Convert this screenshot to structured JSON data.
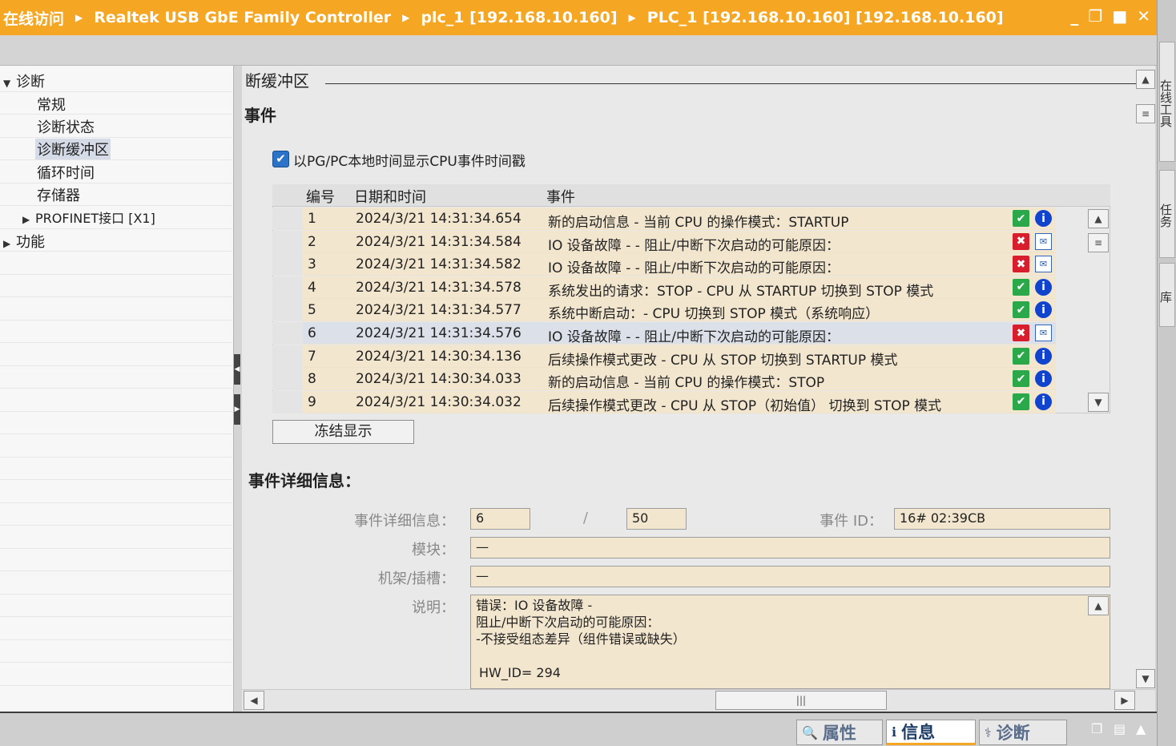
{
  "titlebar": {
    "crumbs": [
      "在线访问",
      "Realtek USB GbE Family Controller",
      "plc_1 [192.168.10.160]",
      "PLC_1 [192.168.10.160] [192.168.10.160]"
    ],
    "minimize": "_",
    "restore": "❐",
    "maximize": "■",
    "close": "✕"
  },
  "right_tabs": [
    "在线工具",
    "任务",
    "库"
  ],
  "tree": {
    "diag": "诊断",
    "general": "常规",
    "status": "诊断状态",
    "buffer": "诊断缓冲区",
    "cycle": "循环时间",
    "memory": "存储器",
    "profinet": "PROFINET接口 [X1]",
    "function": "功能"
  },
  "main": {
    "section_title": "断缓冲区",
    "events_title": "事件",
    "checkbox_label": "以PG/PC本地时间显示CPU事件时间戳",
    "checkbox_checked": true,
    "columns": [
      "编号",
      "日期和时间",
      "事件"
    ],
    "freeze_button": "冻结显示",
    "detail_title": "事件详细信息：",
    "detail": {
      "detail_label": "事件详细信息：",
      "detail_value": "6",
      "slash": "/",
      "total_value": "50",
      "event_id_label": "事件 ID：",
      "event_id_value": "16# 02:39CB",
      "module_label": "模块：",
      "module_value": "—",
      "rack_label": "机架/插槽：",
      "rack_value": "—",
      "desc_label": "说明：",
      "desc_lines": [
        "错误：IO 设备故障 -",
        "阻止/中断下次启动的可能原因：",
        "-不接受组态差异（组件错误或缺失）",
        "",
        "HW_ID=  294"
      ]
    }
  },
  "events": [
    {
      "no": "1",
      "datetime": "2024/3/21 14:31:34.654",
      "event": "新的启动信息 - 当前 CPU 的操作模式：STARTUP",
      "icons": [
        "ok",
        "info"
      ]
    },
    {
      "no": "2",
      "datetime": "2024/3/21 14:31:34.584",
      "event": "IO 设备故障 - - 阻止/中断下次启动的可能原因：",
      "icons": [
        "err",
        "mail"
      ]
    },
    {
      "no": "3",
      "datetime": "2024/3/21 14:31:34.582",
      "event": "IO 设备故障 - - 阻止/中断下次启动的可能原因：",
      "icons": [
        "err",
        "mail"
      ]
    },
    {
      "no": "4",
      "datetime": "2024/3/21 14:31:34.578",
      "event": "系统发出的请求：STOP - CPU 从 STARTUP 切换到 STOP 模式",
      "icons": [
        "ok",
        "info"
      ]
    },
    {
      "no": "5",
      "datetime": "2024/3/21 14:31:34.577",
      "event": "系统中断启动：- CPU 切换到 STOP 模式（系统响应）",
      "icons": [
        "ok",
        "info"
      ]
    },
    {
      "no": "6",
      "datetime": "2024/3/21 14:31:34.576",
      "event": "IO 设备故障 - - 阻止/中断下次启动的可能原因：",
      "icons": [
        "err",
        "mail"
      ],
      "selected": true
    },
    {
      "no": "7",
      "datetime": "2024/3/21 14:30:34.136",
      "event": "后续操作模式更改 - CPU 从 STOP 切换到 STARTUP 模式",
      "icons": [
        "ok",
        "info"
      ]
    },
    {
      "no": "8",
      "datetime": "2024/3/21 14:30:34.033",
      "event": "新的启动信息 - 当前 CPU 的操作模式：STOP",
      "icons": [
        "ok",
        "info"
      ]
    },
    {
      "no": "9",
      "datetime": "2024/3/21 14:30:34.032",
      "event": "后续操作模式更改 - CPU 从 STOP（初始值） 切换到 STOP 模式",
      "icons": [
        "ok",
        "info"
      ]
    }
  ],
  "bottom_tabs": {
    "properties": "属性",
    "info": "信息",
    "diagnostics": "诊断"
  },
  "icon_names": {
    "ok": "checkmark-icon",
    "info": "info-icon",
    "err": "error-icon",
    "mail": "message-icon"
  },
  "colors": {
    "title_bar": "#f5a623",
    "row_bg": "#f3e6cf",
    "selected_row": "#dbe0e9"
  }
}
